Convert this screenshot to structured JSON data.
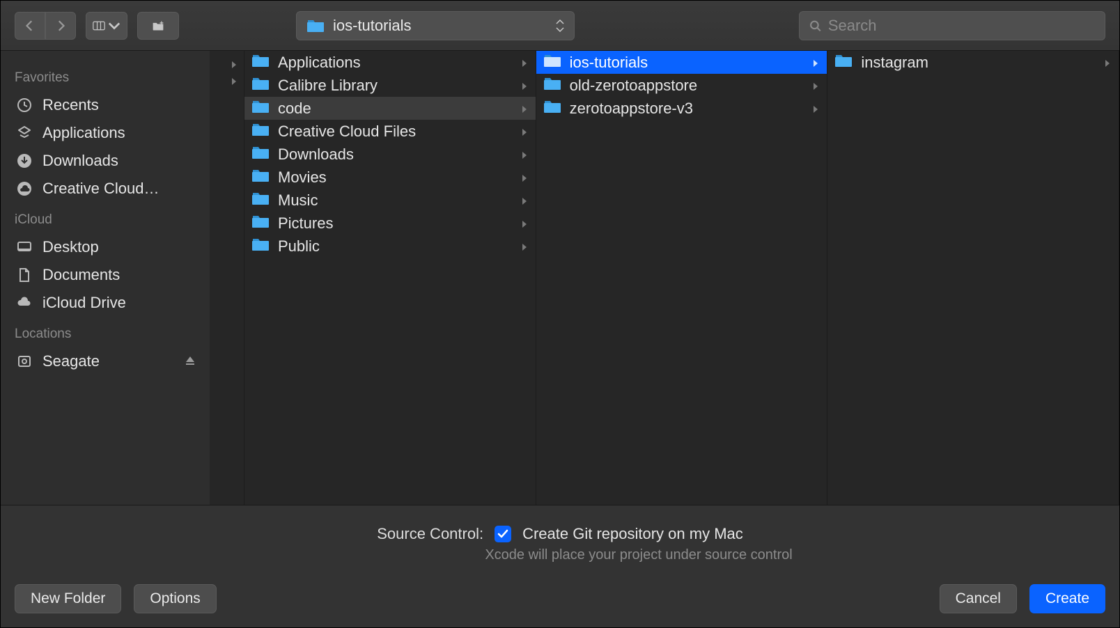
{
  "toolbar": {
    "location_name": "ios-tutorials",
    "search_placeholder": "Search"
  },
  "sidebar": {
    "sections": [
      {
        "heading": "Favorites",
        "items": [
          {
            "icon": "recents",
            "label": "Recents"
          },
          {
            "icon": "applications",
            "label": "Applications"
          },
          {
            "icon": "downloads",
            "label": "Downloads"
          },
          {
            "icon": "creative-cloud",
            "label": "Creative Cloud…"
          }
        ]
      },
      {
        "heading": "iCloud",
        "items": [
          {
            "icon": "desktop",
            "label": "Desktop"
          },
          {
            "icon": "documents",
            "label": "Documents"
          },
          {
            "icon": "icloud-drive",
            "label": "iCloud Drive"
          }
        ]
      },
      {
        "heading": "Locations",
        "items": [
          {
            "icon": "disk",
            "label": "Seagate",
            "ejectable": true
          }
        ]
      }
    ]
  },
  "columns": {
    "col1": [
      {
        "label": "Applications",
        "has_children": true
      },
      {
        "label": "Calibre Library",
        "has_children": true
      },
      {
        "label": "code",
        "has_children": true,
        "dim_selected": true
      },
      {
        "label": "Creative Cloud Files",
        "has_children": true
      },
      {
        "label": "Downloads",
        "has_children": true
      },
      {
        "label": "Movies",
        "has_children": true
      },
      {
        "label": "Music",
        "has_children": true
      },
      {
        "label": "Pictures",
        "has_children": true
      },
      {
        "label": "Public",
        "has_children": true
      }
    ],
    "col2": [
      {
        "label": "ios-tutorials",
        "has_children": true,
        "selected": true
      },
      {
        "label": "old-zerotoappstore",
        "has_children": true
      },
      {
        "label": "zerotoappstore-v3",
        "has_children": true
      }
    ],
    "col3": [
      {
        "label": "instagram",
        "has_children": true
      }
    ]
  },
  "source_control": {
    "label": "Source Control:",
    "checkbox_checked": true,
    "option_label": "Create Git repository on my Mac",
    "subtext": "Xcode will place your project under source control"
  },
  "buttons": {
    "new_folder": "New Folder",
    "options": "Options",
    "cancel": "Cancel",
    "create": "Create"
  }
}
